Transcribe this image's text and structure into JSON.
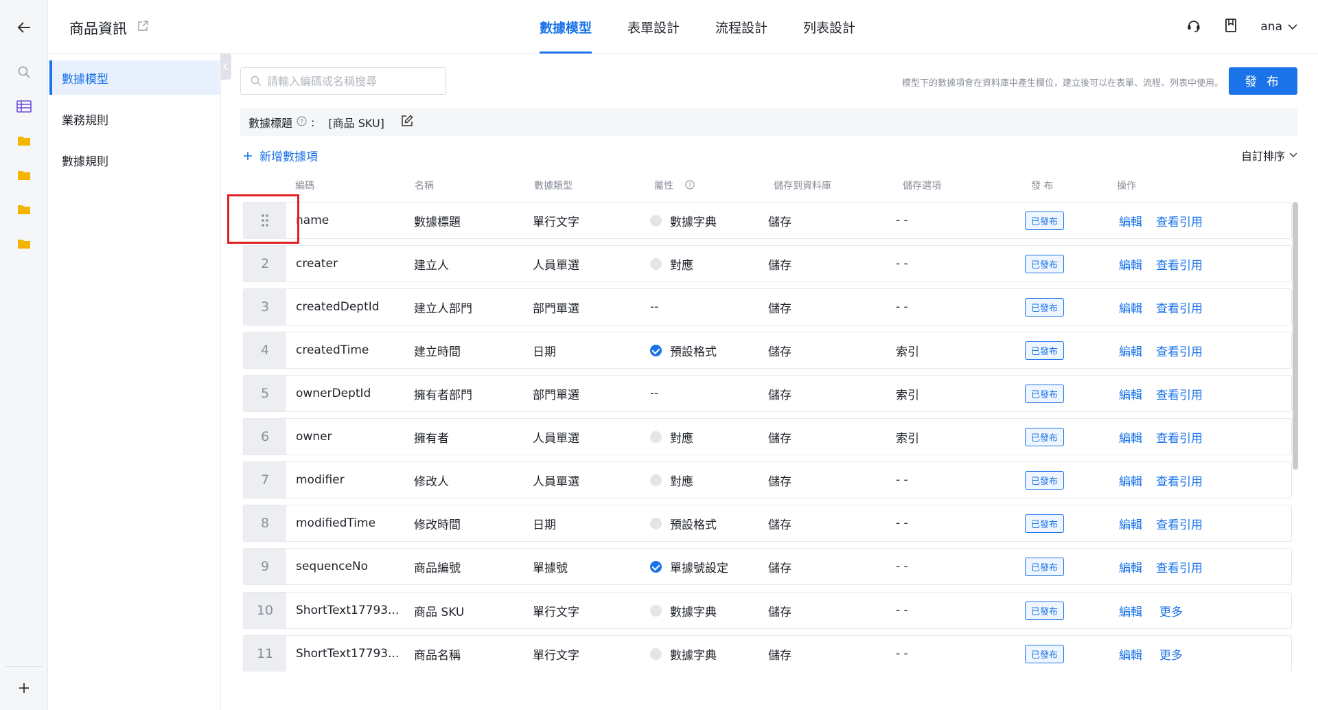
{
  "header": {
    "title": "商品資訊",
    "tabs": [
      {
        "label": "數據模型",
        "active": true
      },
      {
        "label": "表單設計",
        "active": false
      },
      {
        "label": "流程設計",
        "active": false
      },
      {
        "label": "列表設計",
        "active": false
      }
    ],
    "user": "ana"
  },
  "sidebar": {
    "items": [
      {
        "label": "數據模型",
        "active": true
      },
      {
        "label": "業務規則",
        "active": false
      },
      {
        "label": "數據規則",
        "active": false
      }
    ]
  },
  "toolbar": {
    "search_placeholder": "請輸入編碼或名稱搜尋",
    "hint": "模型下的數據項會在資料庫中產生欄位，建立後可以在表單、流程、列表中使用。",
    "publish_label": "發 布",
    "title_label": "數據標題",
    "title_colon": ":",
    "title_value": "[商品 SKU]",
    "add_label": "新增數據項",
    "sort_label": "自訂排序"
  },
  "table": {
    "headers": {
      "code": "編碼",
      "name": "名稱",
      "type": "數據類型",
      "attr": "屬性",
      "store": "儲存到資料庫",
      "option": "儲存選項",
      "publish": "發 布",
      "action": "操作"
    },
    "rows": [
      {
        "idx": "",
        "code": "name",
        "name": "數據標題",
        "type": "單行文字",
        "attr": "數據字典",
        "attr_dot": "off",
        "store": "儲存",
        "option": "- -",
        "status": "已發布",
        "edit": "編輯",
        "more": "查看引用"
      },
      {
        "idx": "2",
        "code": "creater",
        "name": "建立人",
        "type": "人員單選",
        "attr": "對應",
        "attr_dot": "off",
        "store": "儲存",
        "option": "- -",
        "status": "已發布",
        "edit": "編輯",
        "more": "查看引用"
      },
      {
        "idx": "3",
        "code": "createdDeptId",
        "name": "建立人部門",
        "type": "部門單選",
        "attr": "--",
        "attr_dot": "none",
        "store": "儲存",
        "option": "- -",
        "status": "已發布",
        "edit": "編輯",
        "more": "查看引用"
      },
      {
        "idx": "4",
        "code": "createdTime",
        "name": "建立時間",
        "type": "日期",
        "attr": "預設格式",
        "attr_dot": "on",
        "store": "儲存",
        "option": "索引",
        "status": "已發布",
        "edit": "編輯",
        "more": "查看引用"
      },
      {
        "idx": "5",
        "code": "ownerDeptId",
        "name": "擁有者部門",
        "type": "部門單選",
        "attr": "--",
        "attr_dot": "none",
        "store": "儲存",
        "option": "索引",
        "status": "已發布",
        "edit": "編輯",
        "more": "查看引用"
      },
      {
        "idx": "6",
        "code": "owner",
        "name": "擁有者",
        "type": "人員單選",
        "attr": "對應",
        "attr_dot": "off",
        "store": "儲存",
        "option": "索引",
        "status": "已發布",
        "edit": "編輯",
        "more": "查看引用"
      },
      {
        "idx": "7",
        "code": "modifier",
        "name": "修改人",
        "type": "人員單選",
        "attr": "對應",
        "attr_dot": "off",
        "store": "儲存",
        "option": "- -",
        "status": "已發布",
        "edit": "編輯",
        "more": "查看引用"
      },
      {
        "idx": "8",
        "code": "modifiedTime",
        "name": "修改時間",
        "type": "日期",
        "attr": "預設格式",
        "attr_dot": "off",
        "store": "儲存",
        "option": "- -",
        "status": "已發布",
        "edit": "編輯",
        "more": "查看引用"
      },
      {
        "idx": "9",
        "code": "sequenceNo",
        "name": "商品編號",
        "type": "單據號",
        "attr": "單據號設定",
        "attr_dot": "on",
        "store": "儲存",
        "option": "- -",
        "status": "已發布",
        "edit": "編輯",
        "more": "查看引用"
      },
      {
        "idx": "10",
        "code": "ShortText17793...",
        "name": "商品 SKU",
        "type": "單行文字",
        "attr": "數據字典",
        "attr_dot": "off",
        "store": "儲存",
        "option": "- -",
        "status": "已發布",
        "edit": "編輯",
        "more": "更多"
      },
      {
        "idx": "11",
        "code": "ShortText17793...",
        "name": "商品名稱",
        "type": "單行文字",
        "attr": "數據字典",
        "attr_dot": "off",
        "store": "儲存",
        "option": "- -",
        "status": "已發布",
        "edit": "編輯",
        "more": "更多"
      }
    ]
  },
  "colors": {
    "accent": "#1a73e8",
    "highlight": "#e02020",
    "folder": "#f5b400"
  }
}
